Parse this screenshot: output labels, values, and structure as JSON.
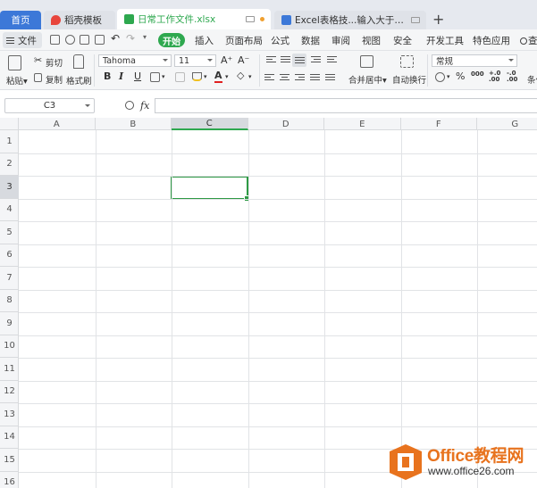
{
  "tabs": [
    {
      "label": "首页"
    },
    {
      "label": "稻壳模板"
    },
    {
      "label": "日常工作文件.xlsx"
    },
    {
      "label": "Excel表格技...输入大于等于符号"
    }
  ],
  "add_tab": "+",
  "menu": {
    "file": "文件",
    "items": [
      "开始",
      "插入",
      "页面布局",
      "公式",
      "数据",
      "审阅",
      "视图",
      "安全",
      "开发工具",
      "特色应用"
    ],
    "search": "查"
  },
  "ribbon": {
    "paste": "粘贴",
    "cut": "剪切",
    "copy": "复制",
    "format_painter": "格式刷",
    "font_name": "Tahoma",
    "font_size": "11",
    "bold": "B",
    "italic": "I",
    "underline": "U",
    "font_color": "A",
    "grow_font": "A⁺",
    "shrink_font": "A⁻",
    "merge_center": "合并居中",
    "wrap_text": "自动换行",
    "number_format": "常规",
    "percent": "%",
    "thousands": "000",
    "inc_decimal": "+.0\n.00",
    "dec_decimal": "-.0\n.00",
    "conditional": "条件"
  },
  "formula_bar": {
    "cell_ref": "C3",
    "fx": "fx",
    "value": ""
  },
  "columns": [
    "A",
    "B",
    "C",
    "D",
    "E",
    "F",
    "G"
  ],
  "rows": [
    "1",
    "2",
    "3",
    "4",
    "5",
    "6",
    "7",
    "8",
    "9",
    "10",
    "11",
    "12",
    "13",
    "14",
    "15",
    "16"
  ],
  "selected": {
    "col": "C",
    "row": "3"
  },
  "watermark": {
    "title": "Office教程网",
    "url": "www.office26.com"
  },
  "colors": {
    "accent": "#2ea84f",
    "home_tab": "#3c78d8",
    "watermark": "#e8731e"
  }
}
